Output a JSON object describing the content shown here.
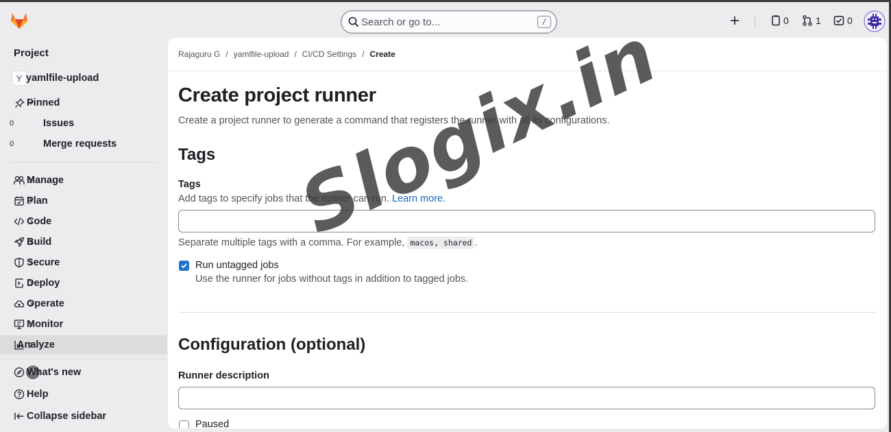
{
  "topbar": {
    "search_placeholder": "Search or go to...",
    "search_shortcut": "/",
    "issues_count": "0",
    "merge_requests_count": "1",
    "todos_count": "0"
  },
  "sidebar": {
    "context_title": "Project",
    "project": {
      "initial": "Y",
      "name": "yamlfile-upload"
    },
    "pinned": {
      "label": "Pinned",
      "items": [
        {
          "label": "Issues",
          "count": "0"
        },
        {
          "label": "Merge requests",
          "count": "0"
        }
      ]
    },
    "nav": [
      {
        "label": "Manage",
        "icon": "users-icon"
      },
      {
        "label": "Plan",
        "icon": "calendar-icon"
      },
      {
        "label": "Code",
        "icon": "code-icon"
      },
      {
        "label": "Build",
        "icon": "rocket-icon"
      },
      {
        "label": "Secure",
        "icon": "shield-icon"
      },
      {
        "label": "Deploy",
        "icon": "deploy-icon"
      },
      {
        "label": "Operate",
        "icon": "cloud-icon"
      },
      {
        "label": "Monitor",
        "icon": "monitor-icon"
      },
      {
        "label": "Analyze",
        "icon": "chart-icon"
      }
    ],
    "footer": {
      "whats_new": "What's new",
      "whats_new_count": "3",
      "help": "Help",
      "collapse": "Collapse sidebar"
    }
  },
  "breadcrumb": [
    "Rajaguru G",
    "yamlfile-upload",
    "CI/CD Settings",
    "Create"
  ],
  "page": {
    "title": "Create project runner",
    "description": "Create a project runner to generate a command that registers the runner with all its configurations.",
    "tags_section": {
      "heading": "Tags",
      "field_label": "Tags",
      "help_text": "Add tags to specify jobs that the runner can run.",
      "learn_more": "Learn more.",
      "input_value": "",
      "example_prefix": "Separate multiple tags with a comma. For example,",
      "example_code": "macos, shared",
      "example_suffix": ".",
      "untagged_label": "Run untagged jobs",
      "untagged_help": "Use the runner for jobs without tags in addition to tagged jobs.",
      "untagged_checked": true
    },
    "config_section": {
      "heading": "Configuration (optional)",
      "description_label": "Runner description",
      "description_value": "",
      "next_checkbox_label": "Paused"
    }
  },
  "watermark": "Slogix.in",
  "colors": {
    "accent": "#1f75cb",
    "link": "#1068bf",
    "sidebar_bg": "#ececef",
    "gitlab_orange": "#e24329"
  }
}
